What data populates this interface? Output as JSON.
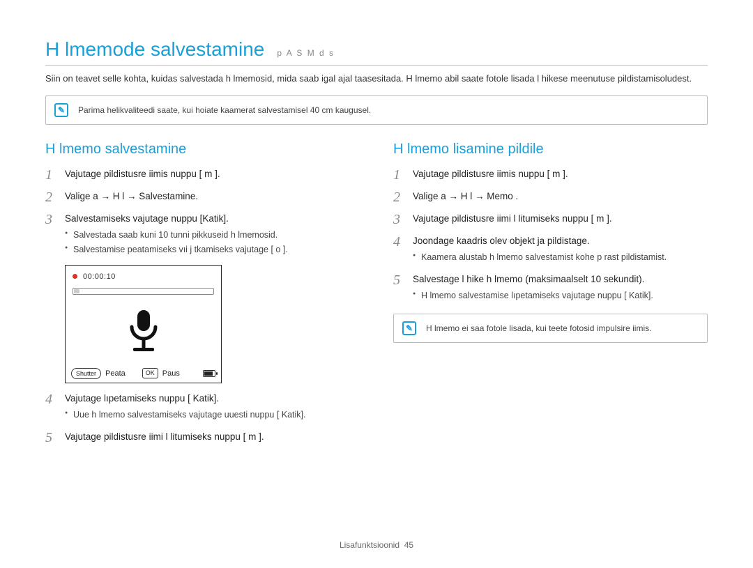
{
  "title": "H  lmemode salvestamine",
  "mode_tags": "p A S M d s",
  "intro": "Siin on teavet selle kohta, kuidas salvestada h  lmemosid, mida saab igal ajal taasesitada. H  lmemo abil saate fotole lisada l     hikese meenutuse pildistamisoludest.",
  "top_tip": "Parima helikvaliteedi saate, kui hoiate kaamerat salvestamisel 40 cm kaugusel.",
  "left": {
    "title": "H  lmemo salvestamine",
    "steps": {
      "s1": "Vajutage pildistusre iimis nuppu [ m        ].",
      "s2": "Valige a    → H  l   → Salvestamine.",
      "s3": "Salvestamiseks vajutage nuppu [Katik].",
      "s3_b1": "Salvestada saab kuni 10 tunni pikkuseid h  lmemosid.",
      "s3_b2": "Salvestamise peatamiseks vıi j tkamiseks vajutage [  o    ].",
      "s4": "Vajutage lıpetamiseks nuppu [ Katik].",
      "s4_b1": "Uue h  lmemo salvestamiseks vajutage uuesti nuppu [  Katik].",
      "s5": "Vajutage pildistusre iimi l litumiseks nuppu [  m        ]."
    }
  },
  "recorder": {
    "time": "00:00:10",
    "btn_left": "Shutter",
    "txt_left": "Peata",
    "btn_mid": "OK",
    "txt_mid": "Paus"
  },
  "right": {
    "title": "H  lmemo lisamine pildile",
    "steps": {
      "s1": "Vajutage pildistusre iimis nuppu [ m        ].",
      "s2": "Valige a    → H  l   → Memo .",
      "s3": "Vajutage pildistusre iimi l litumiseks nuppu [  m        ].",
      "s4": "Joondage kaadris olev objekt ja pildistage.",
      "s4_b1": "Kaamera alustab h  lmemo salvestamist kohe p rast pildistamist.",
      "s5": "Salvestage l hike h  lmemo (maksimaalselt 10 sekundit).",
      "s5_b1": "H  lmemo salvestamise lıpetamiseks vajutage nuppu [  Katik]."
    },
    "tip": "H  lmemo ei saa fotole lisada, kui teete fotosid impulsire iimis."
  },
  "footer": {
    "section": "Lisafunktsioonid",
    "page": "45"
  }
}
